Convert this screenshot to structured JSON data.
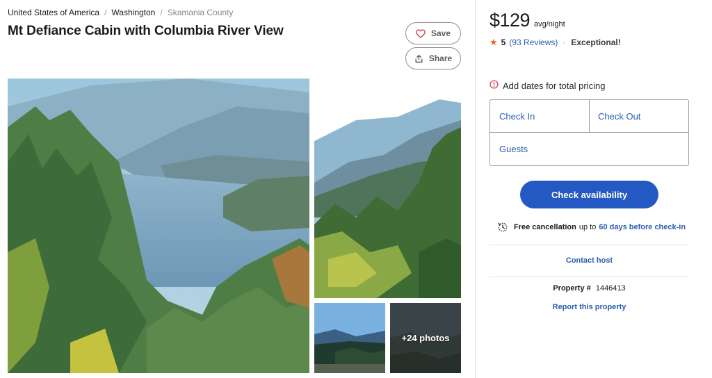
{
  "breadcrumb": {
    "items": [
      "United States of America",
      "Washington",
      "Skamania County"
    ],
    "separator": "/"
  },
  "listing": {
    "title": "Mt Defiance Cabin with Columbia River View"
  },
  "actions": {
    "save_label": "Save",
    "share_label": "Share",
    "save_icon": "heart-icon",
    "share_icon": "share-icon"
  },
  "gallery": {
    "more_photos_label": "+24 photos"
  },
  "booking": {
    "price": "$129",
    "price_unit": "avg/night",
    "rating_score": "5",
    "reviews_label": "(93 Reviews)",
    "rating_separator": "·",
    "rating_label": "Exceptional!",
    "star_color": "#e8612c",
    "notice_text": "Add dates for total pricing",
    "notice_icon": "alert-circle-icon",
    "check_in_label": "Check In",
    "check_out_label": "Check Out",
    "guests_label": "Guests",
    "cta_label": "Check availability",
    "cta_color": "#2459c4",
    "cancellation": {
      "strong": "Free cancellation",
      "middle": "up to",
      "link": "60 days before check-in",
      "icon": "history-icon"
    },
    "contact_label": "Contact host",
    "property_label": "Property #",
    "property_number": "1446413",
    "report_label": "Report this property"
  },
  "theme": {
    "link_color": "#2a5db0",
    "accent_color": "#2459c4",
    "alert_color": "#d0384a"
  }
}
